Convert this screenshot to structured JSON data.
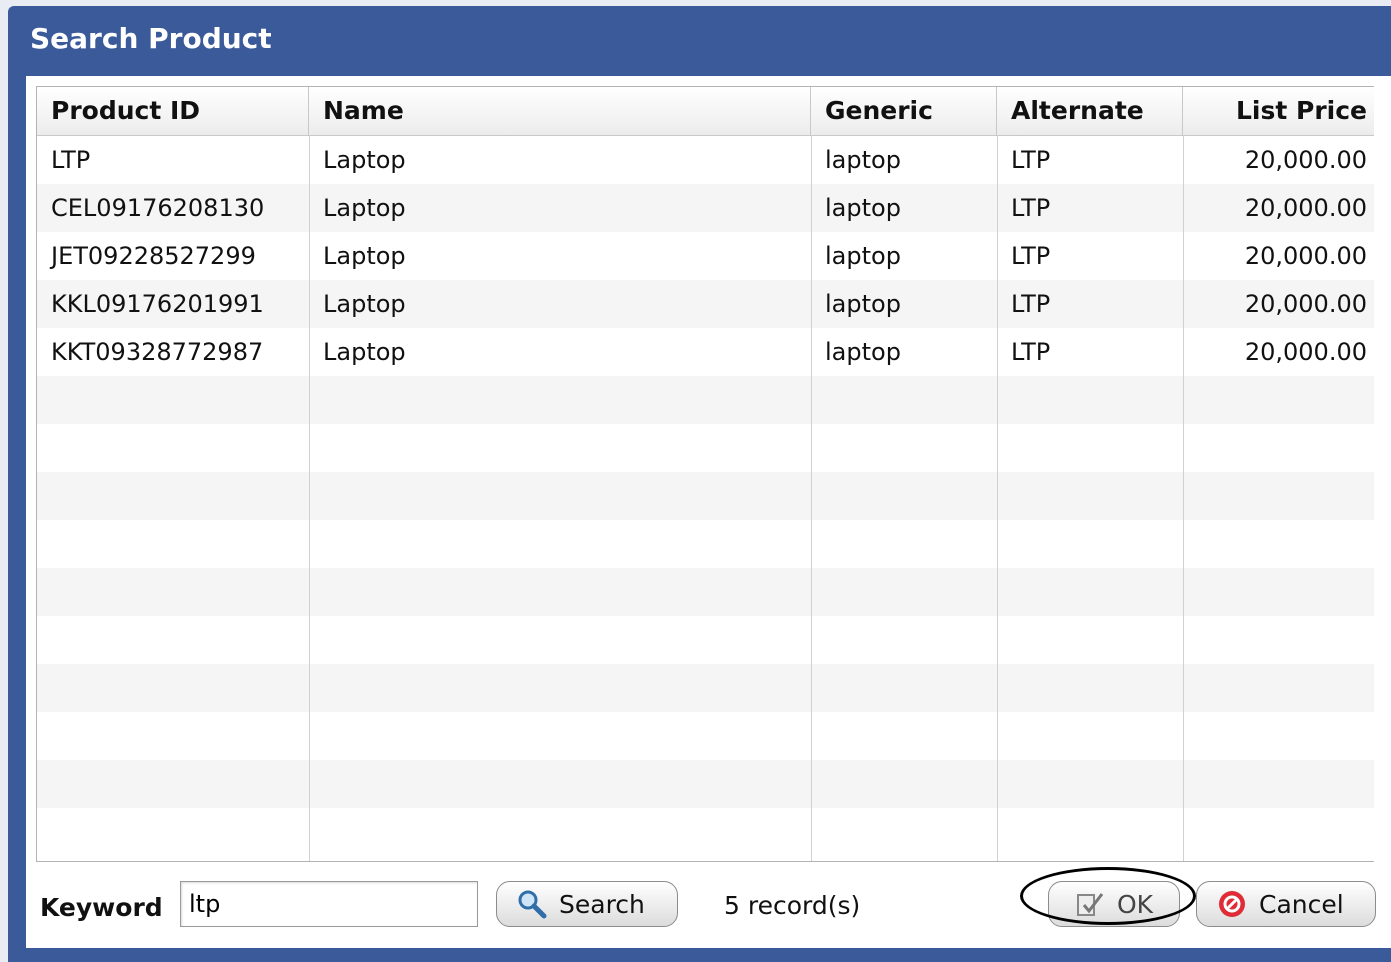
{
  "dialog": {
    "title": "Search Product"
  },
  "table": {
    "columns": [
      "Product ID",
      "Name",
      "Generic",
      "Alternate",
      "List Price"
    ],
    "rows": [
      [
        "LTP",
        "Laptop",
        "laptop",
        "LTP",
        "20,000.00"
      ],
      [
        "CEL09176208130",
        "Laptop",
        "laptop",
        "LTP",
        "20,000.00"
      ],
      [
        "JET09228527299",
        "Laptop",
        "laptop",
        "LTP",
        "20,000.00"
      ],
      [
        "KKL09176201991",
        "Laptop",
        "laptop",
        "LTP",
        "20,000.00"
      ],
      [
        "KKT09328772987",
        "Laptop",
        "laptop",
        "LTP",
        "20,000.00"
      ]
    ]
  },
  "footer": {
    "keyword_label": "Keyword",
    "keyword_value": "ltp",
    "search_label": "Search",
    "record_count": "5 record(s)",
    "ok_label": "OK",
    "cancel_label": "Cancel"
  },
  "colors": {
    "dialog_header": "#3b5a9a",
    "cancel_icon": "#e02c36"
  },
  "icons": {
    "search": "magnifier-icon",
    "ok": "ok-check-icon",
    "cancel": "cancel-circle-icon"
  }
}
